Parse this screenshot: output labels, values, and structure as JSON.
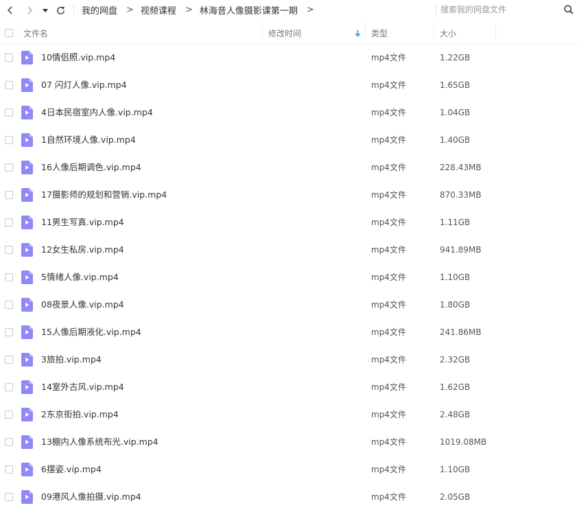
{
  "toolbar": {
    "back_icon": "chevron-left-icon",
    "forward_icon": "chevron-right-icon",
    "history_icon": "caret-down-icon",
    "refresh_icon": "refresh-icon"
  },
  "breadcrumb": {
    "items": [
      "我的网盘",
      "视频课程",
      "林海音人像摄影课第一期"
    ],
    "separator": ">"
  },
  "search": {
    "placeholder": "搜索我的网盘文件",
    "value": ""
  },
  "columns": {
    "name": "文件名",
    "modified": "修改时间",
    "type": "类型",
    "size": "大小",
    "sort_icon": "sort-arrow-down-icon",
    "sort_color": "#2b9ceb"
  },
  "file_icon": {
    "name": "video-file-icon",
    "color": "#8f88f6"
  },
  "files": [
    {
      "name": "10情侣照.vip.mp4",
      "type": "mp4文件",
      "size": "1.22GB"
    },
    {
      "name": "07 闪灯人像.vip.mp4",
      "type": "mp4文件",
      "size": "1.65GB"
    },
    {
      "name": "4日本民宿室内人像.vip.mp4",
      "type": "mp4文件",
      "size": "1.04GB"
    },
    {
      "name": "1自然环境人像.vip.mp4",
      "type": "mp4文件",
      "size": "1.40GB"
    },
    {
      "name": "16人像后期调色.vip.mp4",
      "type": "mp4文件",
      "size": "228.43MB"
    },
    {
      "name": "17摄影师的规划和营销.vip.mp4",
      "type": "mp4文件",
      "size": "870.33MB"
    },
    {
      "name": "11男生写真.vip.mp4",
      "type": "mp4文件",
      "size": "1.11GB"
    },
    {
      "name": "12女生私房.vip.mp4",
      "type": "mp4文件",
      "size": "941.89MB"
    },
    {
      "name": "5情绪人像.vip.mp4",
      "type": "mp4文件",
      "size": "1.10GB"
    },
    {
      "name": "08夜景人像.vip.mp4",
      "type": "mp4文件",
      "size": "1.80GB"
    },
    {
      "name": "15人像后期液化.vip.mp4",
      "type": "mp4文件",
      "size": "241.86MB"
    },
    {
      "name": "3旅拍.vip.mp4",
      "type": "mp4文件",
      "size": "2.32GB"
    },
    {
      "name": "14室外古风.vip.mp4",
      "type": "mp4文件",
      "size": "1.62GB"
    },
    {
      "name": "2东京街拍.vip.mp4",
      "type": "mp4文件",
      "size": "2.48GB"
    },
    {
      "name": "13棚内人像系统布光.vip.mp4",
      "type": "mp4文件",
      "size": "1019.08MB"
    },
    {
      "name": "6摆姿.vip.mp4",
      "type": "mp4文件",
      "size": "1.10GB"
    },
    {
      "name": "09港风人像拍摄.vip.mp4",
      "type": "mp4文件",
      "size": "2.05GB"
    }
  ]
}
